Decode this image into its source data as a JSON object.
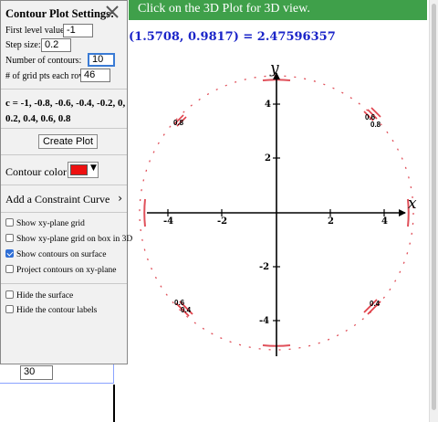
{
  "banner": {
    "text": "Click on the 3D Plot for 3D view."
  },
  "readout": {
    "text": "(1.5708, 0.9817) = 2.47596357"
  },
  "panel": {
    "title": "Contour Plot Settings:",
    "fields": [
      {
        "label": "First level value:",
        "value": "-1"
      },
      {
        "label": "Step size:",
        "value": "0.2"
      },
      {
        "label": "Number of contours:",
        "value": "10"
      },
      {
        "label": "# of grid pts each row:",
        "value": "46"
      }
    ],
    "levels_text": "c = -1, -0.8, -0.6, -0.4, -0.2, 0, 0.2, 0.4, 0.6, 0.8",
    "create_button": "Create Plot",
    "color_label": "Contour color:",
    "contour_color": "#ee1111",
    "constraint_label": "Add a Constraint Curve",
    "checkboxes": [
      {
        "label": "Show xy-plane grid",
        "checked": false
      },
      {
        "label": "Show xy-plane grid on box in 3D",
        "checked": false
      },
      {
        "label": "Show contours on surface",
        "checked": true
      },
      {
        "label": "Project contours on xy-plane",
        "checked": false
      },
      {
        "label": "Hide the surface",
        "checked": false
      },
      {
        "label": "Hide the contour labels",
        "checked": false
      }
    ]
  },
  "behind_panel": {
    "value": "30"
  },
  "plot": {
    "x_axis_label": "x",
    "y_axis_label": "y",
    "x_ticks": [
      "-4",
      "-2",
      "2",
      "4"
    ],
    "y_ticks": [
      "4",
      "2",
      "-2",
      "-4"
    ],
    "contour_labels": [
      "0.8",
      "0.6",
      "0.8",
      "0.6",
      "0.4",
      "0.4"
    ]
  }
}
